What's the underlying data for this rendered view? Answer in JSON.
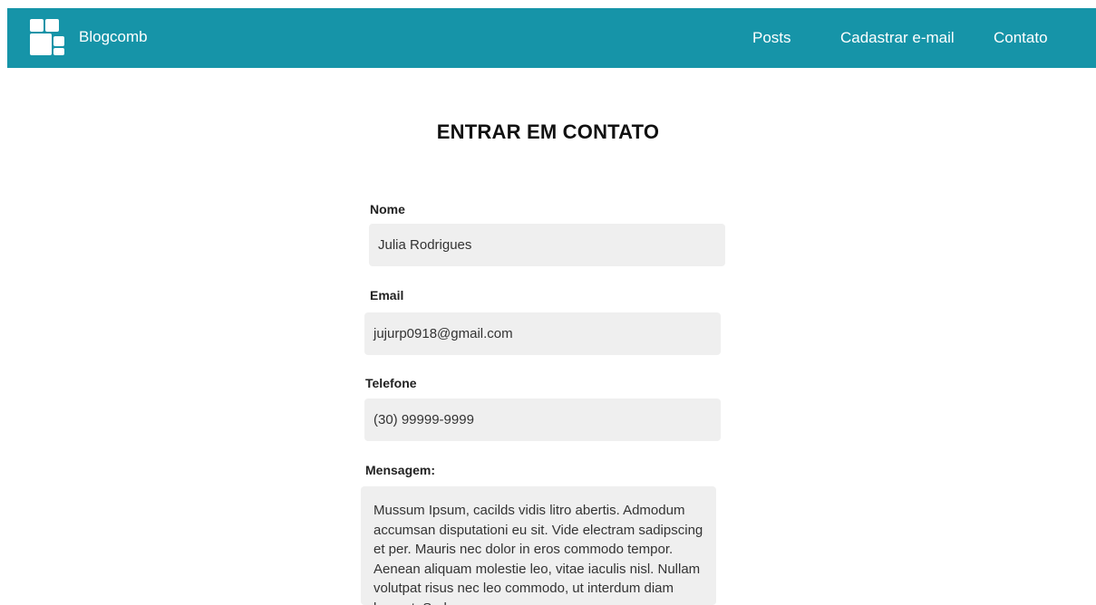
{
  "header": {
    "brand": "Blogcomb",
    "nav": [
      {
        "label": "Posts"
      },
      {
        "label": "Cadastrar e-mail"
      },
      {
        "label": "Contato"
      }
    ],
    "bg_color": "#1694a8"
  },
  "main": {
    "title": "ENTRAR EM CONTATO"
  },
  "form": {
    "name_label": "Nome",
    "name_value": "Julia Rodrigues",
    "email_label": "Email",
    "email_value": "jujurp0918@gmail.com",
    "phone_label": "Telefone",
    "phone_value": "(30) 99999-9999",
    "message_label": "Mensagem:",
    "message_value": "Mussum Ipsum, cacilds vidis litro abertis. Admodum accumsan disputationi eu sit. Vide electram sadipscing et per. Mauris nec dolor in eros commodo tempor. Aenean aliquam molestie leo, vitae iaculis nisl. Nullam volutpat risus nec leo commodo, ut interdum diam laoreet. Sed..."
  }
}
